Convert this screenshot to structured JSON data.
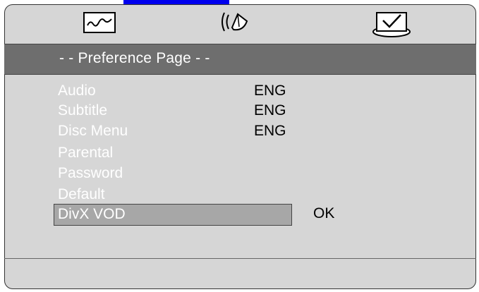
{
  "tabs": [
    {
      "id": "general",
      "icon": "waveform-icon"
    },
    {
      "id": "audio",
      "icon": "speaker-icon"
    },
    {
      "id": "preference",
      "icon": "checkbox-icon"
    }
  ],
  "header": {
    "title": "- - Preference Page - -"
  },
  "settings": [
    {
      "label": "Audio",
      "value": "ENG"
    },
    {
      "label": "Subtitle",
      "value": "ENG"
    },
    {
      "label": "Disc Menu",
      "value": "ENG"
    },
    {
      "label": "Parental",
      "value": ""
    },
    {
      "label": "Password",
      "value": ""
    },
    {
      "label": "Default",
      "value": ""
    },
    {
      "label": "DivX VOD",
      "value": "OK",
      "selected": true
    }
  ],
  "colors": {
    "background": "#d6d6d6",
    "header_bar": "#6e6e6e",
    "selection": "#a7a7a7",
    "accent": "#0000ee"
  }
}
